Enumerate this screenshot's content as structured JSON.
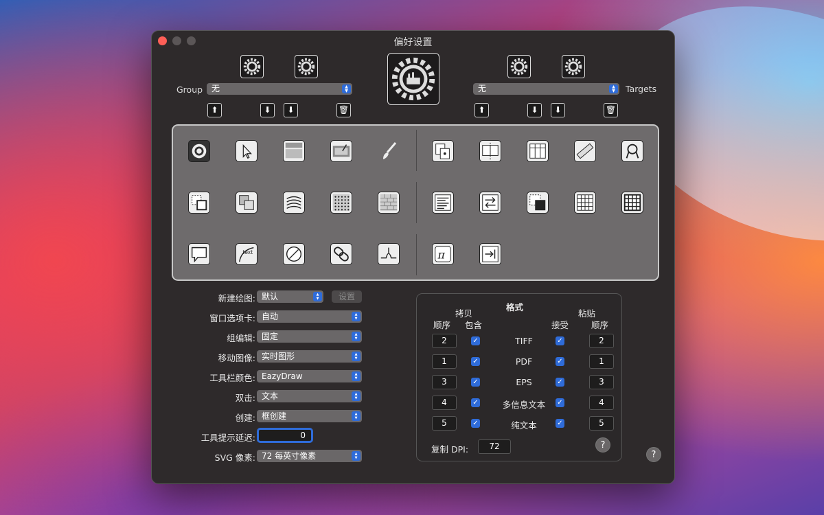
{
  "window": {
    "title": "偏好设置"
  },
  "group": {
    "label": "Group",
    "value": "无"
  },
  "targets": {
    "label": "Targets",
    "value": "无"
  },
  "settings": [
    {
      "label": "新建绘图:",
      "value": "默认"
    },
    {
      "label": "窗口选项卡:",
      "value": "自动"
    },
    {
      "label": "组编辑:",
      "value": "固定"
    },
    {
      "label": "移动图像:",
      "value": "实时图形"
    },
    {
      "label": "工具栏颜色:",
      "value": "EazyDraw"
    },
    {
      "label": "双击:",
      "value": "文本"
    },
    {
      "label": "创建:",
      "value": "框创建"
    },
    {
      "label": "工具提示延迟:",
      "value": "0"
    },
    {
      "label": "SVG 像素:",
      "value": "72 每英寸像素"
    }
  ],
  "set_button": "设置",
  "formats": {
    "title": "格式",
    "copy_header": "拷贝",
    "paste_header": "粘贴",
    "col_order": "顺序",
    "col_include": "包含",
    "col_accept": "接受",
    "col_order2": "顺序",
    "rows": [
      {
        "name": "TIFF",
        "copy_order": "2",
        "paste_order": "2"
      },
      {
        "name": "PDF",
        "copy_order": "1",
        "paste_order": "1"
      },
      {
        "name": "EPS",
        "copy_order": "3",
        "paste_order": "3"
      },
      {
        "name": "多信息文本",
        "copy_order": "4",
        "paste_order": "4"
      },
      {
        "name": "纯文本",
        "copy_order": "5",
        "paste_order": "5"
      }
    ],
    "dpi_label": "复制 DPI:",
    "dpi_value": "72",
    "check": "✓",
    "help": "?"
  },
  "help": "?",
  "icons": {
    "arrow_up": "⬆",
    "arrow_down": "⬇",
    "trash": "🗑"
  }
}
